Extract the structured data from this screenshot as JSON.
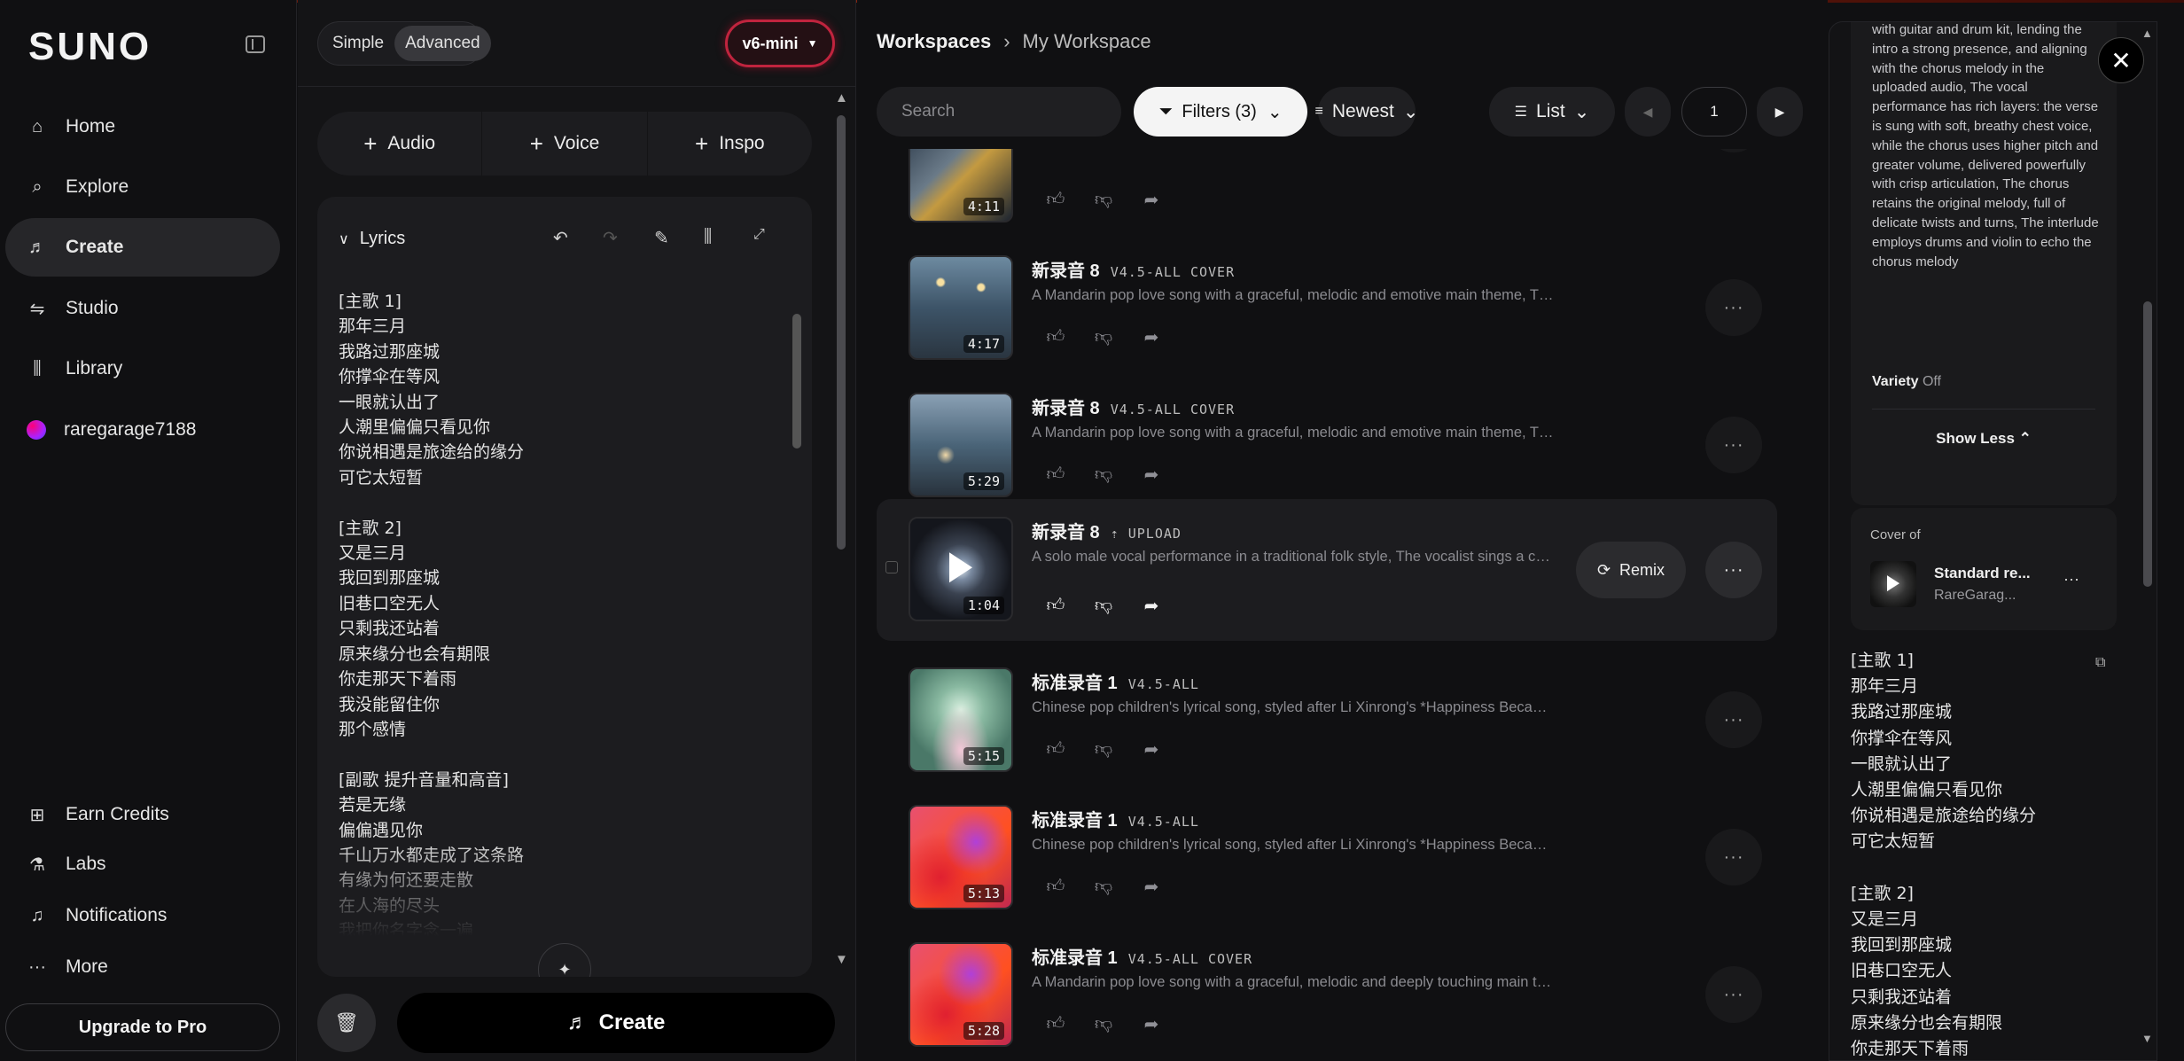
{
  "app": {
    "logo": "SUNO"
  },
  "sidebar": {
    "items": [
      {
        "label": "Home",
        "icon": "⌂"
      },
      {
        "label": "Explore",
        "icon": "⌕"
      },
      {
        "label": "Create",
        "icon": "♬"
      },
      {
        "label": "Studio",
        "icon": "⇋"
      },
      {
        "label": "Library",
        "icon": "‖\\"
      },
      {
        "label": "raregarage7188",
        "icon": "avatar"
      }
    ],
    "bottom": [
      {
        "label": "Earn Credits",
        "icon": "🎁"
      },
      {
        "label": "Labs",
        "icon": "⚗"
      },
      {
        "label": "Notifications",
        "icon": "🔔"
      },
      {
        "label": "More",
        "icon": "···"
      }
    ],
    "upgrade": "Upgrade to Pro"
  },
  "create": {
    "mode_simple": "Simple",
    "mode_advanced": "Advanced",
    "model": "v6-mini",
    "add_audio": "Audio",
    "add_voice": "Voice",
    "add_inspo": "Inspo",
    "lyrics_title": "Lyrics",
    "lyrics": "[主歌 1]\n那年三月\n我路过那座城\n你撑伞在等风\n一眼就认出了\n人潮里偏偏只看见你\n你说相遇是旅途给的缘分\n可它太短暂\n\n[主歌 2]\n又是三月\n我回到那座城\n旧巷口空无人\n只剩我还站着\n原来缘分也会有期限\n你走那天下着雨\n我没能留住你\n那个感情\n\n[副歌 提升音量和高音]\n若是无缘\n偏偏遇见你\n千山万水都走成了这条路\n有缘为何还要走散\n在人海的尽头\n我把你名字念一遍",
    "create_label": "Create"
  },
  "workspace": {
    "breadcrumb_root": "Workspaces",
    "breadcrumb_current": "My Workspace",
    "search_placeholder": "Search",
    "filters_label": "Filters (3)",
    "sort_label": "Newest",
    "view_label": "List",
    "page": "1",
    "rows": [
      {
        "title": "",
        "tag": "",
        "desc": "",
        "duration": "4:11",
        "art": "art-city"
      },
      {
        "title": "新录音 8",
        "tag": "V4.5-ALL COVER",
        "desc": "A Mandarin pop love song with a graceful, melodic and emotive main theme, The vocalist sings with expressive tone",
        "duration": "4:17",
        "art": "art-rain"
      },
      {
        "title": "新录音 8",
        "tag": "V4.5-ALL COVER",
        "desc": "A Mandarin pop love song with a graceful, melodic and emotive main theme, The vocalist sings with expressive tone",
        "duration": "5:29",
        "art": "art-window"
      },
      {
        "title": "新录音 8",
        "tag": "⇡ UPLOAD",
        "desc": "A solo male vocal performance in a traditional folk style, The vocalist sings a cappella with raw emotion",
        "duration": "1:04",
        "art": "art-burst",
        "remix": "Remix"
      },
      {
        "title": "标准录音 1",
        "tag": "V4.5-ALL",
        "desc": "Chinese pop children's lyrical song, styled after Li Xinrong's *Happiness Because of You*, with gentle melody",
        "duration": "5:15",
        "art": "art-forest"
      },
      {
        "title": "标准录音 1",
        "tag": "V4.5-ALL",
        "desc": "Chinese pop children's lyrical song, styled after Li Xinrong's *Happiness Because of You*, with gentle melody",
        "duration": "5:13",
        "art": "art-pink"
      },
      {
        "title": "标准录音 1",
        "tag": "V4.5-ALL COVER",
        "desc": "A Mandarin pop love song with a graceful, melodic and deeply touching main theme, The vocalist sings softly",
        "duration": "5:28",
        "art": "art-pink"
      }
    ]
  },
  "detail": {
    "description": "with guitar and drum kit, lending the intro a strong presence, and aligning with the chorus melody in the uploaded audio, The vocal performance has rich layers: the verse is sung with soft, breathy chest voice, while the chorus uses higher pitch and greater volume, delivered powerfully with crisp articulation, The chorus retains the original melody, full of delicate twists and turns, The interlude employs drums and violin to echo the chorus melody",
    "variety_label": "Variety",
    "variety_value": "Off",
    "show_less": "Show Less ⌃",
    "cover_of_label": "Cover of",
    "cover_title": "Standard re...",
    "cover_author": "RareGarag...",
    "lyrics": "[主歌 1]\n那年三月\n我路过那座城\n你撑伞在等风\n一眼就认出了\n人潮里偏偏只看见你\n你说相遇是旅途给的缘分\n可它太短暂\n\n[主歌 2]\n又是三月\n我回到那座城\n旧巷口空无人\n只剩我还站着\n原来缘分也会有期限\n你走那天下着雨"
  }
}
